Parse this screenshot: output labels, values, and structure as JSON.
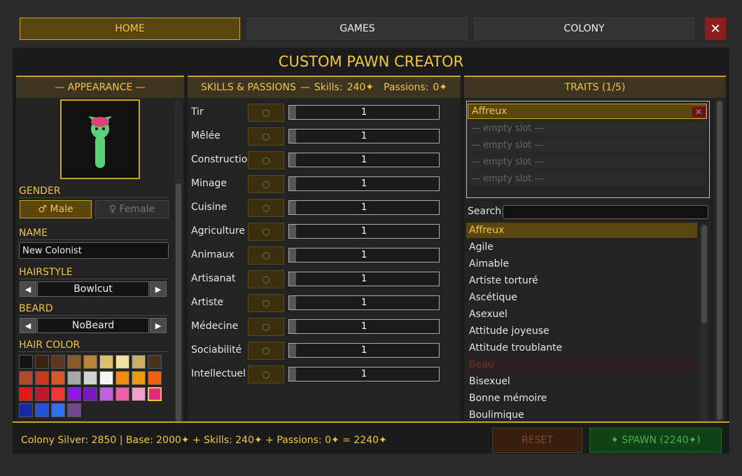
{
  "nav": {
    "home": "HOME",
    "games": "GAMES",
    "colony": "COLONY",
    "close": "✕"
  },
  "title": "CUSTOM PAWN CREATOR",
  "appearance": {
    "header": "— APPEARANCE —",
    "gender_label": "GENDER",
    "male": "♂ Male",
    "female": "♀ Female",
    "name_label": "NAME",
    "name_value": "New Colonist",
    "hairstyle_label": "HAIRSTYLE",
    "hairstyle_value": "Bowlcut",
    "beard_label": "BEARD",
    "beard_value": "NoBeard",
    "haircolor_label": "HAIR COLOR",
    "prev": "◀",
    "next": "▶",
    "hair_colors": [
      "#141414",
      "#3b2414",
      "#5a3a22",
      "#8a5a2e",
      "#b8843a",
      "#dcc06a",
      "#f2e2a0",
      "#c9b06a",
      "#4a3220",
      "#b04a2a",
      "#c43a1a",
      "#d8582a",
      "#a8a8a8",
      "#d0d0d0",
      "#f4f4f4",
      "#f08a10",
      "#e89a10",
      "#f06010",
      "#e01818",
      "#c01a2a",
      "#f03a3a",
      "#9018e0",
      "#7a18c0",
      "#c060e0",
      "#f060a8",
      "#f0a0c8",
      "#e02a80",
      "#1828a0",
      "#2850d8",
      "#3070f0",
      "#704a8a"
    ],
    "selected_hair_index": 26
  },
  "skills": {
    "header_title": "SKILLS & PASSIONS",
    "header_sep": "—",
    "skills_label": "Skills:",
    "skills_value": "240✦",
    "passions_label": "Passions:",
    "passions_value": "0✦",
    "passion_icon": "○",
    "items": [
      {
        "name": "Tir",
        "level": 1
      },
      {
        "name": "Mêlée",
        "level": 1
      },
      {
        "name": "Construction",
        "level": 1
      },
      {
        "name": "Minage",
        "level": 1
      },
      {
        "name": "Cuisine",
        "level": 1
      },
      {
        "name": "Agriculture",
        "level": 1
      },
      {
        "name": "Animaux",
        "level": 1
      },
      {
        "name": "Artisanat",
        "level": 1
      },
      {
        "name": "Artiste",
        "level": 1
      },
      {
        "name": "Médecine",
        "level": 1
      },
      {
        "name": "Sociabilité",
        "level": 1
      },
      {
        "name": "Intellectuel",
        "level": 1
      }
    ],
    "max_level": 20
  },
  "traits": {
    "header": "TRAITS  (1/5)",
    "slots": [
      "Affreux",
      "— empty slot —",
      "— empty slot —",
      "— empty slot —",
      "— empty slot —"
    ],
    "remove_icon": "✕",
    "search_label": "Search:",
    "search_value": "",
    "list": [
      {
        "name": "Affreux",
        "state": "selected"
      },
      {
        "name": "Agile",
        "state": "normal"
      },
      {
        "name": "Aimable",
        "state": "normal"
      },
      {
        "name": "Artiste torturé",
        "state": "normal"
      },
      {
        "name": "Ascétique",
        "state": "normal"
      },
      {
        "name": "Asexuel",
        "state": "normal"
      },
      {
        "name": "Attitude joyeuse",
        "state": "normal"
      },
      {
        "name": "Attitude troublante",
        "state": "normal"
      },
      {
        "name": "Beau",
        "state": "disabled"
      },
      {
        "name": "Bisexuel",
        "state": "normal"
      },
      {
        "name": "Bonne mémoire",
        "state": "normal"
      },
      {
        "name": "Boulimique",
        "state": "normal"
      }
    ]
  },
  "footer": {
    "cost_text": "Colony Silver: 2850  |  Base: 2000✦  +  Skills: 240✦  +  Passions: 0✦  =  2240✦",
    "reset": "RESET",
    "spawn": "✦ SPAWN  (2240✦)"
  },
  "colors": {
    "accent": "#f2c53d",
    "gold": "#c9a227",
    "danger": "#8c1d1d",
    "spawn": "#4caf50"
  }
}
